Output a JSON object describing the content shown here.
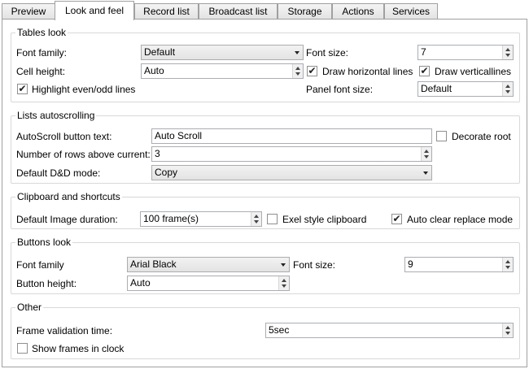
{
  "tabs": [
    {
      "label": "Preview"
    },
    {
      "label": "Look and feel"
    },
    {
      "label": "Record list"
    },
    {
      "label": "Broadcast list"
    },
    {
      "label": "Storage"
    },
    {
      "label": "Actions"
    },
    {
      "label": "Services"
    }
  ],
  "active_tab": "Look and feel",
  "tables_look": {
    "title": "Tables look",
    "font_family_label": "Font family:",
    "font_family_value": "Default",
    "font_size_label": "Font size:",
    "font_size_value": "7",
    "cell_height_label": "Cell height:",
    "cell_height_value": "Auto",
    "draw_horizontal_label": "Draw horizontal lines",
    "draw_horizontal_checked": true,
    "draw_vertical_label": "Draw verticallines",
    "draw_vertical_checked": true,
    "highlight_label": "Highlight even/odd lines",
    "highlight_checked": true,
    "panel_font_size_label": "Panel font size:",
    "panel_font_size_value": "Default"
  },
  "lists_autoscrolling": {
    "title": "Lists autoscrolling",
    "autoscroll_label": "AutoScroll button text:",
    "autoscroll_value": "Auto Scroll",
    "decorate_root_label": "Decorate root",
    "decorate_root_checked": false,
    "rows_above_label": "Number of rows above current:",
    "rows_above_value": "3",
    "dnd_mode_label": "Default D&D mode:",
    "dnd_mode_value": "Copy"
  },
  "clipboard": {
    "title": "Clipboard and shortcuts",
    "image_duration_label": "Default Image duration:",
    "image_duration_value": "100  frame(s)",
    "exel_style_label": "Exel style clipboard",
    "exel_style_checked": false,
    "auto_clear_label": "Auto clear replace mode",
    "auto_clear_checked": true
  },
  "buttons_look": {
    "title": "Buttons look",
    "font_family_label": "Font family",
    "font_family_value": "Arial Black",
    "font_size_label": "Font size:",
    "font_size_value": "9",
    "button_height_label": "Button height:",
    "button_height_value": "Auto"
  },
  "other": {
    "title": "Other",
    "frame_validation_label": "Frame validation time:",
    "frame_validation_value": "5sec",
    "show_frames_label": "Show frames in clock",
    "show_frames_checked": false
  },
  "icons": {
    "check": "✔"
  },
  "colors": {
    "border": "#a0a0a0",
    "group_border": "#d8d8d8",
    "field_border": "#abadb3"
  }
}
